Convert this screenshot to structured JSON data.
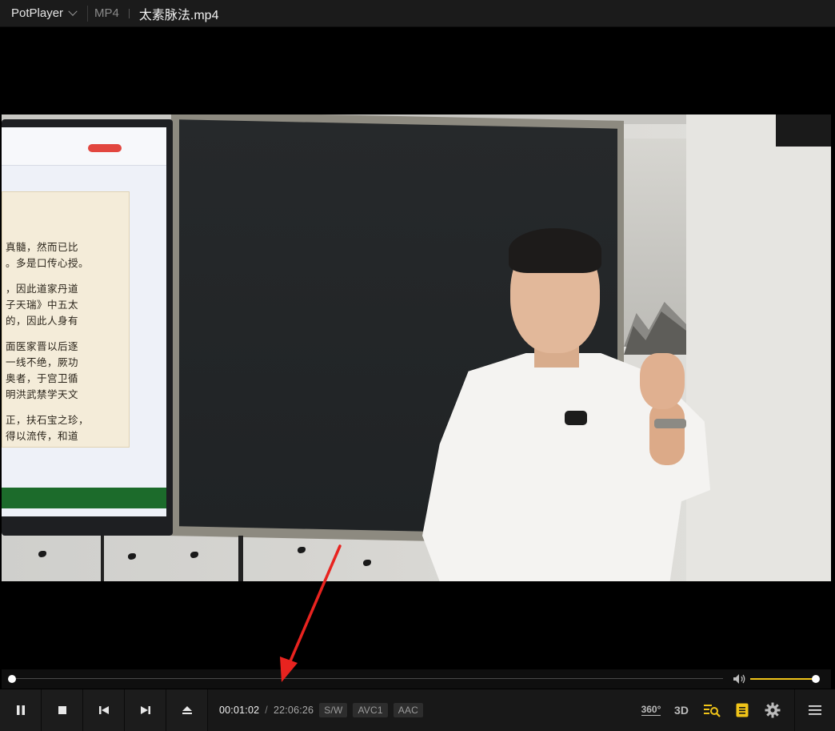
{
  "titlebar": {
    "app_name": "PotPlayer",
    "format": "MP4",
    "file_title": "太素脉法.mp4"
  },
  "video": {
    "document_lines": [
      "真髓，然而已比",
      "。多是口传心授。",
      "，因此道家丹道",
      "子天瑞》中五太",
      "的，因此人身有",
      "面医家晋以后逐",
      "一线不绝，厥功",
      "奥者，于宫卫循",
      "明洪武禁学天文",
      "正，扶石宝之珍，",
      "得以流传，和道"
    ]
  },
  "playback": {
    "progress": 0.0008,
    "volume": 1.0
  },
  "controls": {
    "time_current": "00:01:02",
    "time_separator": "/",
    "time_total": "22:06:26",
    "tags": [
      "S/W",
      "AVC1",
      "AAC"
    ],
    "tool_360": "360°",
    "tool_3d": "3D"
  },
  "colors": {
    "accent": "#f0c419",
    "annotation_arrow": "#e8231f"
  }
}
